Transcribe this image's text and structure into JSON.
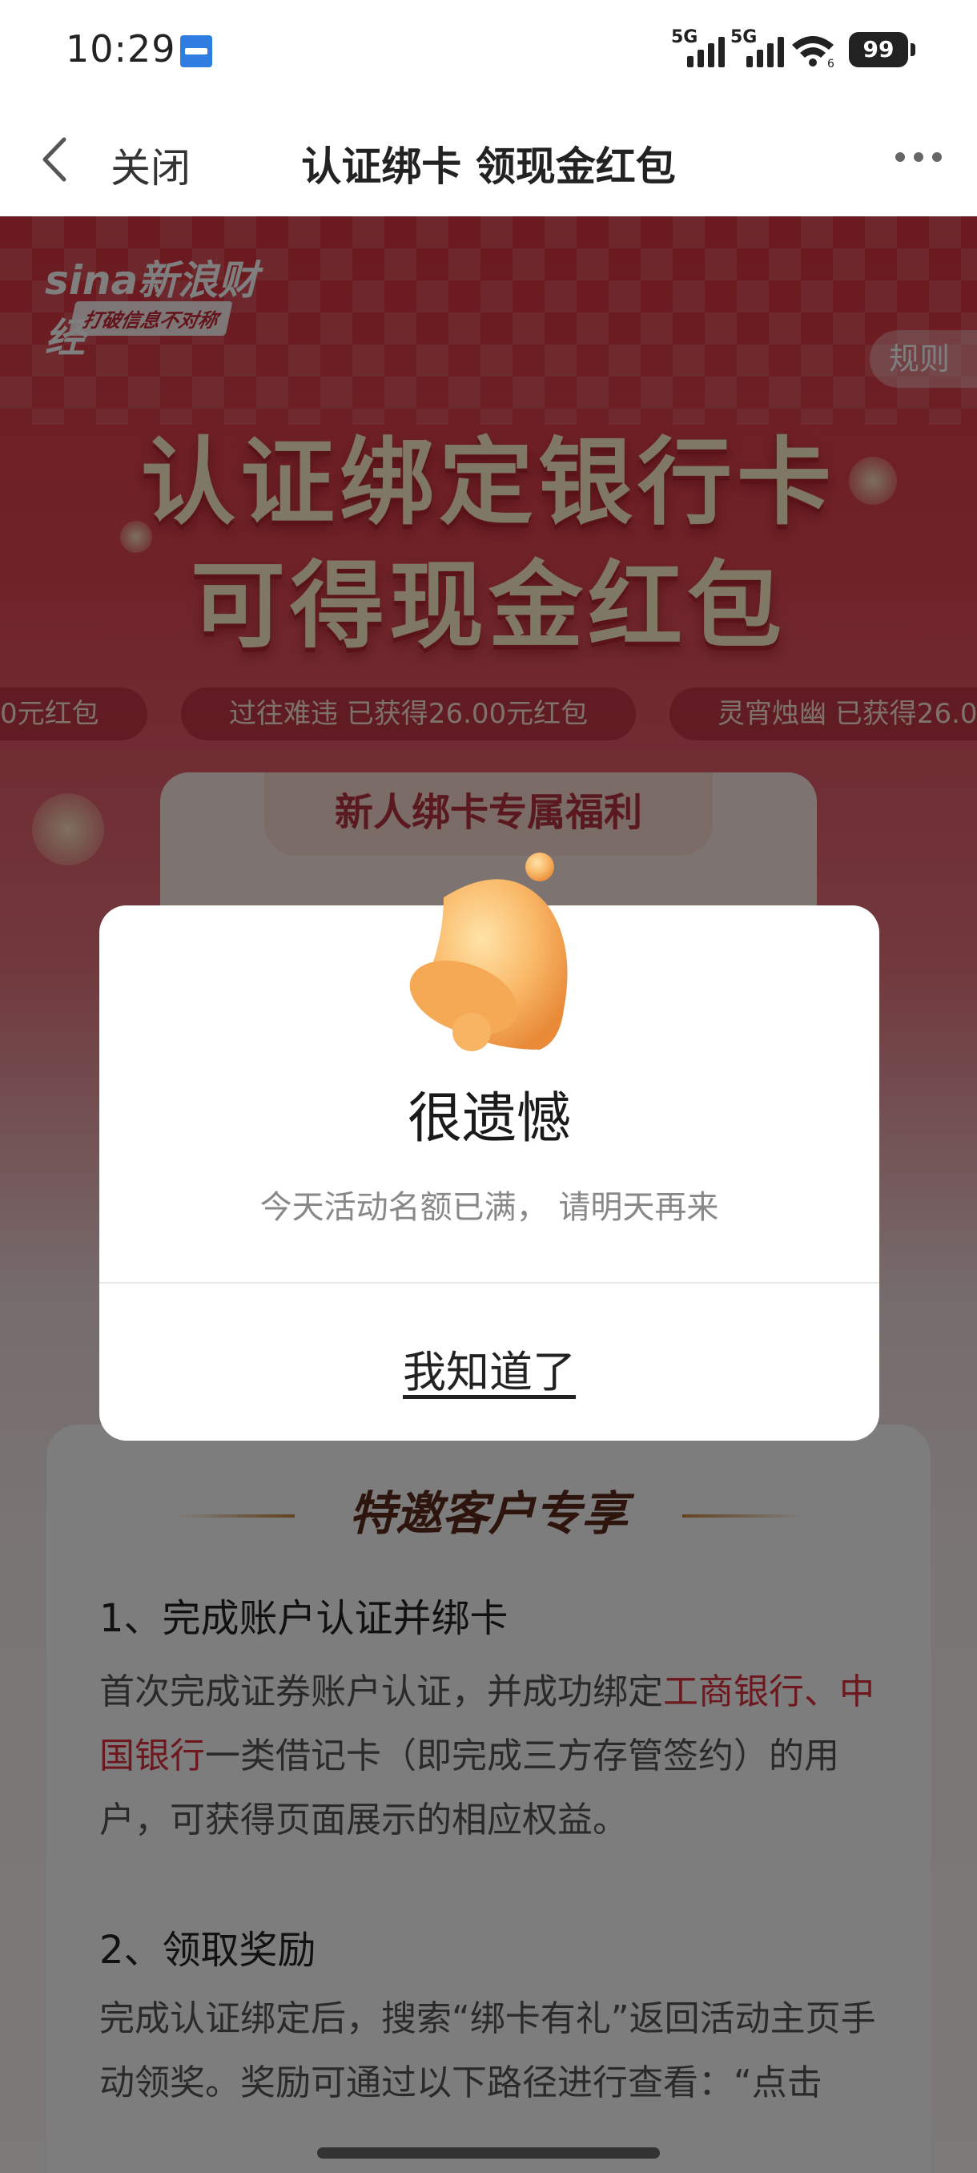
{
  "status_bar": {
    "time": "10:29",
    "app_badge_icon": "news-app-icon",
    "sim1": "5G",
    "sim2": "5G",
    "wifi_sub": "6",
    "battery": "99"
  },
  "nav": {
    "close_label": "关闭",
    "title": "认证绑卡 领现金红包"
  },
  "page": {
    "brand": "sina新浪财经",
    "slogan": "打破信息不对称",
    "rules_label": "规则",
    "hero_line1": "认证绑定银行卡",
    "hero_line2": "可得现金红包",
    "ticker": [
      "0元红包",
      "过往难违 已获得26.00元红包",
      "灵宵烛幽 已获得26.0"
    ],
    "welfare_title": "新人绑卡专属福利",
    "info_header": "特邀客户专享",
    "step1_title": "1、完成账户认证并绑卡",
    "step1_a": "首次完成证券账户认证，并成功绑定",
    "step1_bank1": "工商银行",
    "step1_sep": "、",
    "step1_bank2": "中国银行",
    "step1_b": "一类借记卡（即完成三方存管签约）的用户，可获得页面展示的相应权益。",
    "step2_title": "2、领取奖励",
    "step2_text": "完成认证绑定后，搜索“绑卡有礼”返回活动主页手动领奖。奖励可通过以下路径进行查看：“点击"
  },
  "dialog": {
    "icon": "bell-icon",
    "title": "很遗憾",
    "message": "今天活动名额已满， 请明天再来",
    "confirm": "我知道了"
  },
  "colors": {
    "accent_red": "#d9303c",
    "overlay": "rgba(0,0,0,0.5)"
  }
}
